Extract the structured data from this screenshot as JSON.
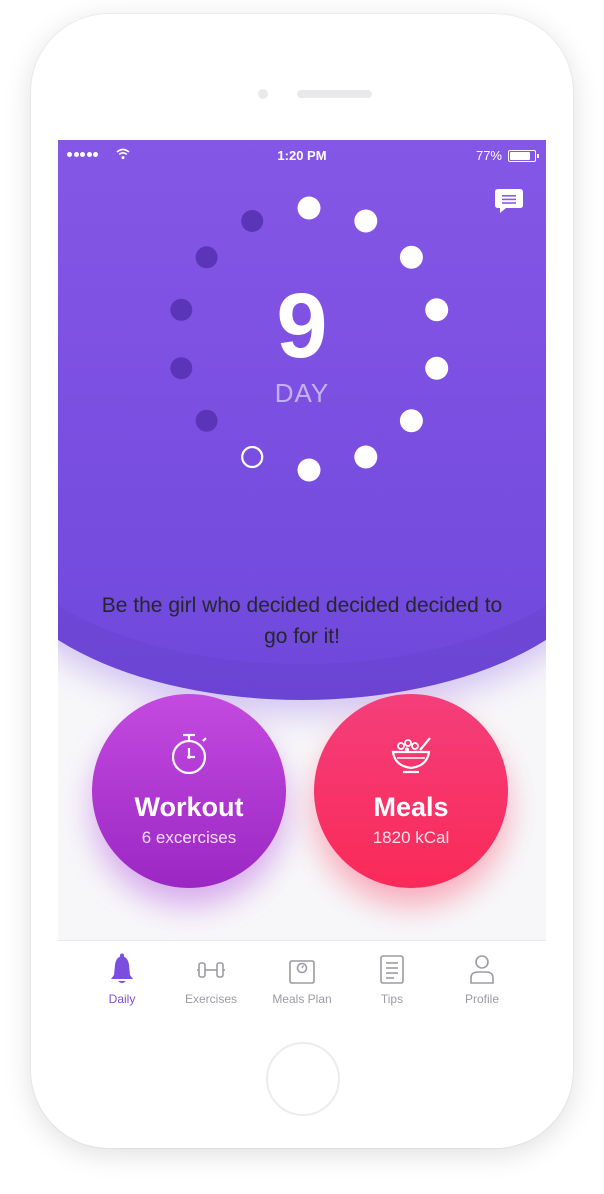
{
  "status_bar": {
    "time": "1:20 PM",
    "battery_percent": "77%",
    "battery_level": 0.77,
    "signal_bars": 5
  },
  "progress": {
    "day_number": "9",
    "day_label": "DAY",
    "total_days": 14,
    "completed_days": 8,
    "current_day": 9
  },
  "motto": "Be the girl who decided decided decided to go for it!",
  "cards": {
    "workout": {
      "title": "Workout",
      "subtitle": "6 excercises",
      "icon": "stopwatch-icon"
    },
    "meals": {
      "title": "Meals",
      "subtitle": "1820 kCal",
      "icon": "food-bowl-icon"
    }
  },
  "tabs": [
    {
      "label": "Daily",
      "icon": "bell-icon",
      "active": true
    },
    {
      "label": "Exercises",
      "icon": "dumbbell-icon",
      "active": false
    },
    {
      "label": "Meals Plan",
      "icon": "scale-icon",
      "active": false
    },
    {
      "label": "Tips",
      "icon": "document-icon",
      "active": false
    },
    {
      "label": "Profile",
      "icon": "user-icon",
      "active": false
    }
  ],
  "colors": {
    "hero_top": "#9462ec",
    "hero_bottom": "#6a44d3",
    "accent": "#7a4fe0",
    "workout": "#b33ad6",
    "meals": "#f7345f",
    "upcoming_dot": "#5a35b8"
  }
}
